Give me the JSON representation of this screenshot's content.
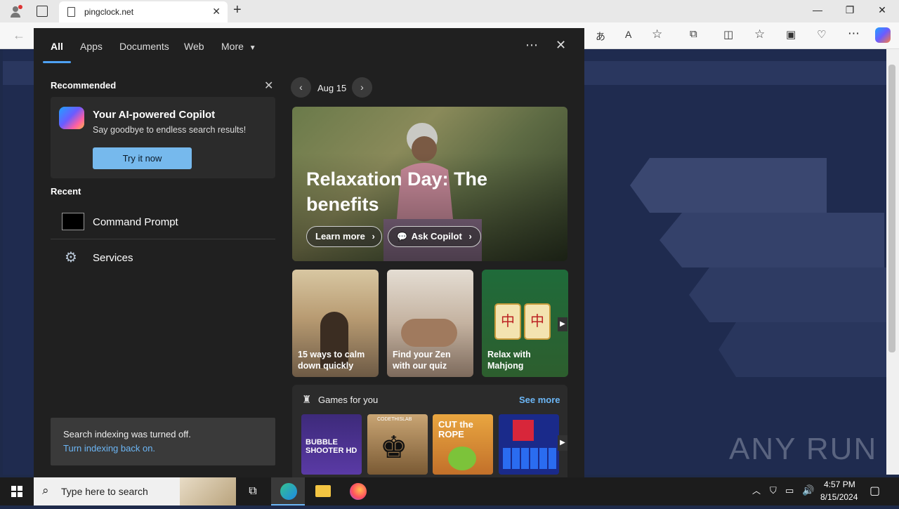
{
  "browser": {
    "tab_title": "pingclock.net",
    "new_tab_symbol": "+",
    "window_controls": [
      "—",
      "❐",
      "✕"
    ]
  },
  "panel": {
    "tabs": [
      "All",
      "Apps",
      "Documents",
      "Web",
      "More"
    ],
    "more_label": "More",
    "recommended": {
      "heading": "Recommended",
      "card_title": "Your AI-powered Copilot",
      "card_subtitle": "Say goodbye to endless search results!",
      "card_button": "Try it now"
    },
    "recent": {
      "heading": "Recent",
      "items": [
        "Command Prompt",
        "Services"
      ]
    },
    "index_notice": {
      "text": "Search indexing was turned off.",
      "link": "Turn indexing back on."
    },
    "date_label": "Aug 15",
    "hero": {
      "title_line1": "Relaxation Day: The",
      "title_line2": "benefits",
      "learn_more": "Learn more",
      "ask_copilot": "Ask Copilot"
    },
    "cards": [
      {
        "line1": "15 ways to calm",
        "line2": "down quickly"
      },
      {
        "line1": "Find your Zen",
        "line2": "with our quiz"
      },
      {
        "line1": "Relax with",
        "line2": "Mahjong"
      }
    ],
    "games": {
      "heading": "Games for you",
      "see_more": "See more",
      "tiles": [
        "BUBBLE SHOOTER HD",
        "CODETHISLAB",
        "CUT the ROPE",
        ""
      ]
    }
  },
  "watermark": "ANY RUN",
  "taskbar": {
    "search_placeholder": "Type here to search",
    "time": "4:57 PM",
    "date": "8/15/2024"
  },
  "colors": {
    "panel_bg": "#202020",
    "accent": "#4ea1f3",
    "button": "#76b9ed",
    "page_bg": "#1f2b4f"
  }
}
